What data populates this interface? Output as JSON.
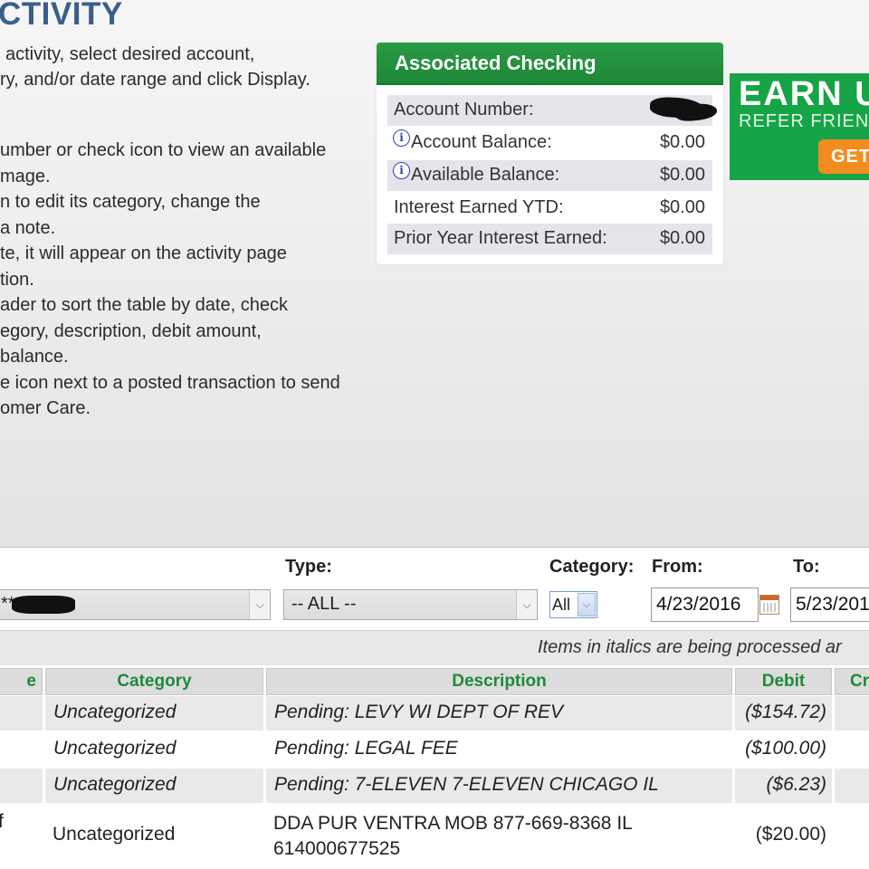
{
  "page": {
    "title": "CTIVITY",
    "instructions": [
      "activity, select desired account,",
      "ry, and/or date range and click Display.",
      "umber or check icon to view an available",
      "mage.",
      "n to edit its category, change the",
      "a note.",
      "te, it will appear on the activity page",
      "tion.",
      "ader to sort the table by date, check",
      "egory, description, debit amount,",
      "balance.",
      "e icon next to a posted transaction to send",
      "omer Care."
    ]
  },
  "account_box": {
    "header": "Associated Checking",
    "rows": [
      {
        "label": "Account Number:",
        "value": ""
      },
      {
        "label": "Account Balance:",
        "value": "$0.00"
      },
      {
        "label": "Available Balance:",
        "value": "$0.00"
      },
      {
        "label": "Interest Earned YTD:",
        "value": "$0.00"
      },
      {
        "label": "Prior Year Interest Earned:",
        "value": "$0.00"
      }
    ]
  },
  "promo": {
    "headline": "EARN U",
    "subline": "REFER FRIEN",
    "button": "GET"
  },
  "filters": {
    "account_value": "**",
    "type_label": "Type:",
    "type_value": "-- ALL --",
    "category_label": "Category:",
    "category_value": "All",
    "from_label": "From:",
    "from_value": "4/23/2016",
    "to_label": "To:",
    "to_value": "5/23/201"
  },
  "info_bar": "Items in italics are being processed ar",
  "table": {
    "headers": {
      "date": "e",
      "category": "Category",
      "description": "Description",
      "debit": "Debit",
      "credit": "Cr"
    },
    "rows": [
      {
        "date": "",
        "category": "Uncategorized",
        "description": "Pending: LEVY WI DEPT OF REV",
        "debit": "($154.72)"
      },
      {
        "date": "",
        "category": "Uncategorized",
        "description": "Pending: LEGAL FEE",
        "debit": "($100.00)"
      },
      {
        "date": "",
        "category": "Uncategorized",
        "description": "Pending: 7-ELEVEN 7-ELEVEN CHICAGO IL",
        "debit": "($6.23)"
      },
      {
        "date": "f",
        "category": "Uncategorized",
        "description": "DDA PUR VENTRA MOB 877-669-8368 IL",
        "description_line2": "614000677525",
        "debit": "($20.00)"
      }
    ]
  }
}
